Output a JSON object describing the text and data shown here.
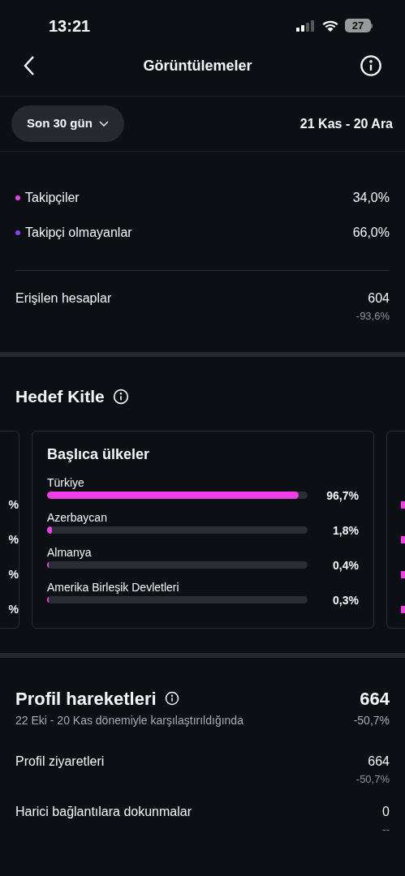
{
  "status_bar": {
    "time": "13:21",
    "battery": "27"
  },
  "header": {
    "title": "Görüntülemeler"
  },
  "filter": {
    "period": "Son 30 gün",
    "range": "21 Kas - 20 Ara"
  },
  "breakdown": [
    {
      "label": "Takipçiler",
      "value": "34,0%",
      "color": "#f23ee6"
    },
    {
      "label": "Takipçi olmayanlar",
      "value": "66,0%",
      "color": "#8b3ff5"
    }
  ],
  "reach": {
    "label": "Erişilen hesaplar",
    "value": "604",
    "change": "-93,6%"
  },
  "audience": {
    "title": "Hedef Kitle",
    "left_card": {
      "values": [
        "%",
        "%",
        "%",
        "%"
      ]
    },
    "card": {
      "title": "Başlıca ülkeler",
      "rows": [
        {
          "label": "Türkiye",
          "value": "96,7%",
          "level": 0.967
        },
        {
          "label": "Azerbaycan",
          "value": "1,8%",
          "level": 0.018
        },
        {
          "label": "Almanya",
          "value": "0,4%",
          "level": 0.004
        },
        {
          "label": "Amerika Birleşik Devletleri",
          "value": "0,3%",
          "level": 0.003
        }
      ]
    }
  },
  "profile_activity": {
    "title": "Profil hareketleri",
    "subtitle": "22 Eki - 20 Kas dönemiyle karşılaştırıldığında",
    "value": "664",
    "change": "-50,7%",
    "rows": [
      {
        "label": "Profil ziyaretleri",
        "value": "664",
        "change": "-50,7%"
      },
      {
        "label": "Harici bağlantılara dokunmalar",
        "value": "0",
        "change": "--"
      }
    ]
  }
}
